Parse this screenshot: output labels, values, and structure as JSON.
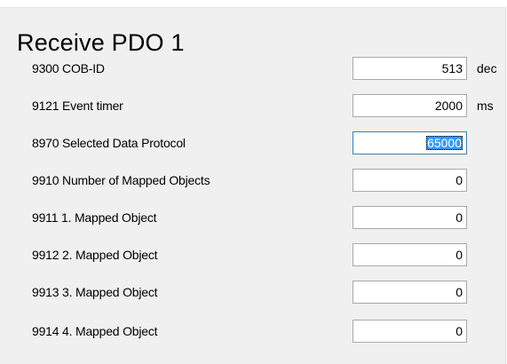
{
  "panel": {
    "title": "Receive PDO 1",
    "rows": [
      {
        "label": "9300 COB-ID",
        "value": "513",
        "unit": "dec"
      },
      {
        "label": "9121 Event timer",
        "value": "2000",
        "unit": "ms"
      },
      {
        "label": "8970 Selected Data Protocol",
        "value": "65000",
        "unit": ""
      },
      {
        "label": "9910 Number of Mapped Objects",
        "value": "0",
        "unit": ""
      },
      {
        "label": "9911 1. Mapped Object",
        "value": "0",
        "unit": ""
      },
      {
        "label": "9912 2. Mapped Object",
        "value": "0",
        "unit": ""
      },
      {
        "label": "9913 3. Mapped Object",
        "value": "0",
        "unit": ""
      },
      {
        "label": "9914 4. Mapped Object",
        "value": "0",
        "unit": ""
      }
    ],
    "focused_field": "8970 Selected Data Protocol",
    "selection_color": "#3399ff"
  }
}
